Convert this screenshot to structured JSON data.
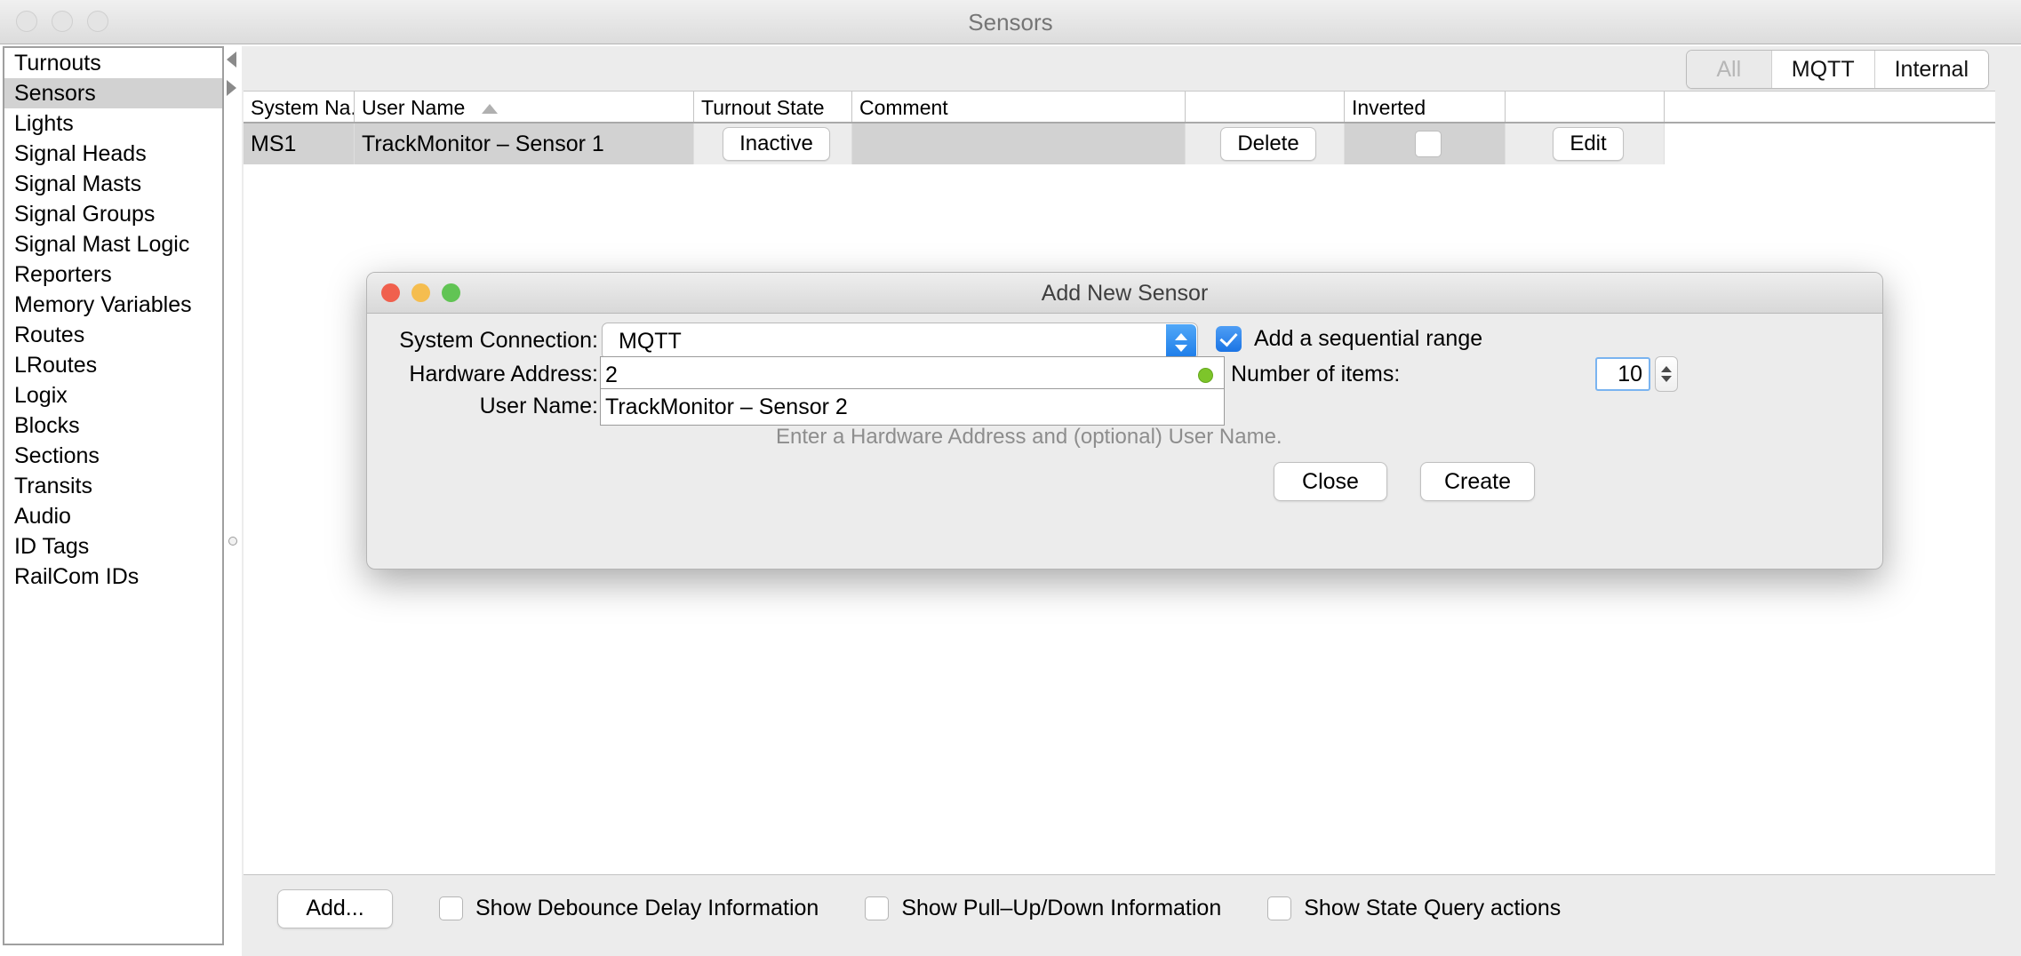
{
  "window": {
    "title": "Sensors"
  },
  "sidebar": {
    "items": [
      {
        "label": "Turnouts",
        "selected": false
      },
      {
        "label": "Sensors",
        "selected": true
      },
      {
        "label": "Lights",
        "selected": false
      },
      {
        "label": "Signal Heads",
        "selected": false
      },
      {
        "label": "Signal Masts",
        "selected": false
      },
      {
        "label": "Signal Groups",
        "selected": false
      },
      {
        "label": "Signal Mast Logic",
        "selected": false
      },
      {
        "label": "Reporters",
        "selected": false
      },
      {
        "label": "Memory Variables",
        "selected": false
      },
      {
        "label": "Routes",
        "selected": false
      },
      {
        "label": "LRoutes",
        "selected": false
      },
      {
        "label": "Logix",
        "selected": false
      },
      {
        "label": "Blocks",
        "selected": false
      },
      {
        "label": "Sections",
        "selected": false
      },
      {
        "label": "Transits",
        "selected": false
      },
      {
        "label": "Audio",
        "selected": false
      },
      {
        "label": "ID Tags",
        "selected": false
      },
      {
        "label": "RailCom IDs",
        "selected": false
      }
    ]
  },
  "tabs": [
    {
      "label": "All",
      "state": "disabled"
    },
    {
      "label": "MQTT",
      "state": "enabled"
    },
    {
      "label": "Internal",
      "state": "enabled"
    }
  ],
  "table": {
    "columns": [
      "System Na...",
      "User Name",
      "Turnout State",
      "Comment",
      "",
      "Inverted",
      ""
    ],
    "sort_column": "User Name",
    "sort_direction": "ascending",
    "rows": [
      {
        "system_name": "MS1",
        "user_name": "TrackMonitor – Sensor 1",
        "turnout_state": "Inactive",
        "comment": "",
        "delete_label": "Delete",
        "inverted": false,
        "edit_label": "Edit"
      }
    ]
  },
  "bottom_bar": {
    "add_button": "Add...",
    "checkboxes": [
      {
        "label": "Show Debounce Delay Information",
        "checked": false
      },
      {
        "label": "Show Pull–Up/Down Information",
        "checked": false
      },
      {
        "label": "Show State Query actions",
        "checked": false
      }
    ]
  },
  "dialog": {
    "title": "Add New Sensor",
    "system_connection": {
      "label": "System Connection:",
      "value": "MQTT"
    },
    "sequential_range": {
      "label": "Add a sequential range",
      "checked": true
    },
    "hardware_address": {
      "label": "Hardware Address:",
      "value": "2",
      "valid": true
    },
    "number_of_items": {
      "label": "Number of items:",
      "value": "10"
    },
    "user_name": {
      "label": "User Name:",
      "value": "TrackMonitor – Sensor 2"
    },
    "hint": "Enter a Hardware Address and (optional) User Name.",
    "buttons": {
      "close": "Close",
      "create": "Create"
    }
  },
  "colors": {
    "accent_blue": "#1b74e4",
    "valid_green": "#7dc52a",
    "selection_gray": "#d2d2d2",
    "dot_red": "#f0604d",
    "dot_yellow": "#f5bd4f",
    "dot_green": "#61c454"
  }
}
